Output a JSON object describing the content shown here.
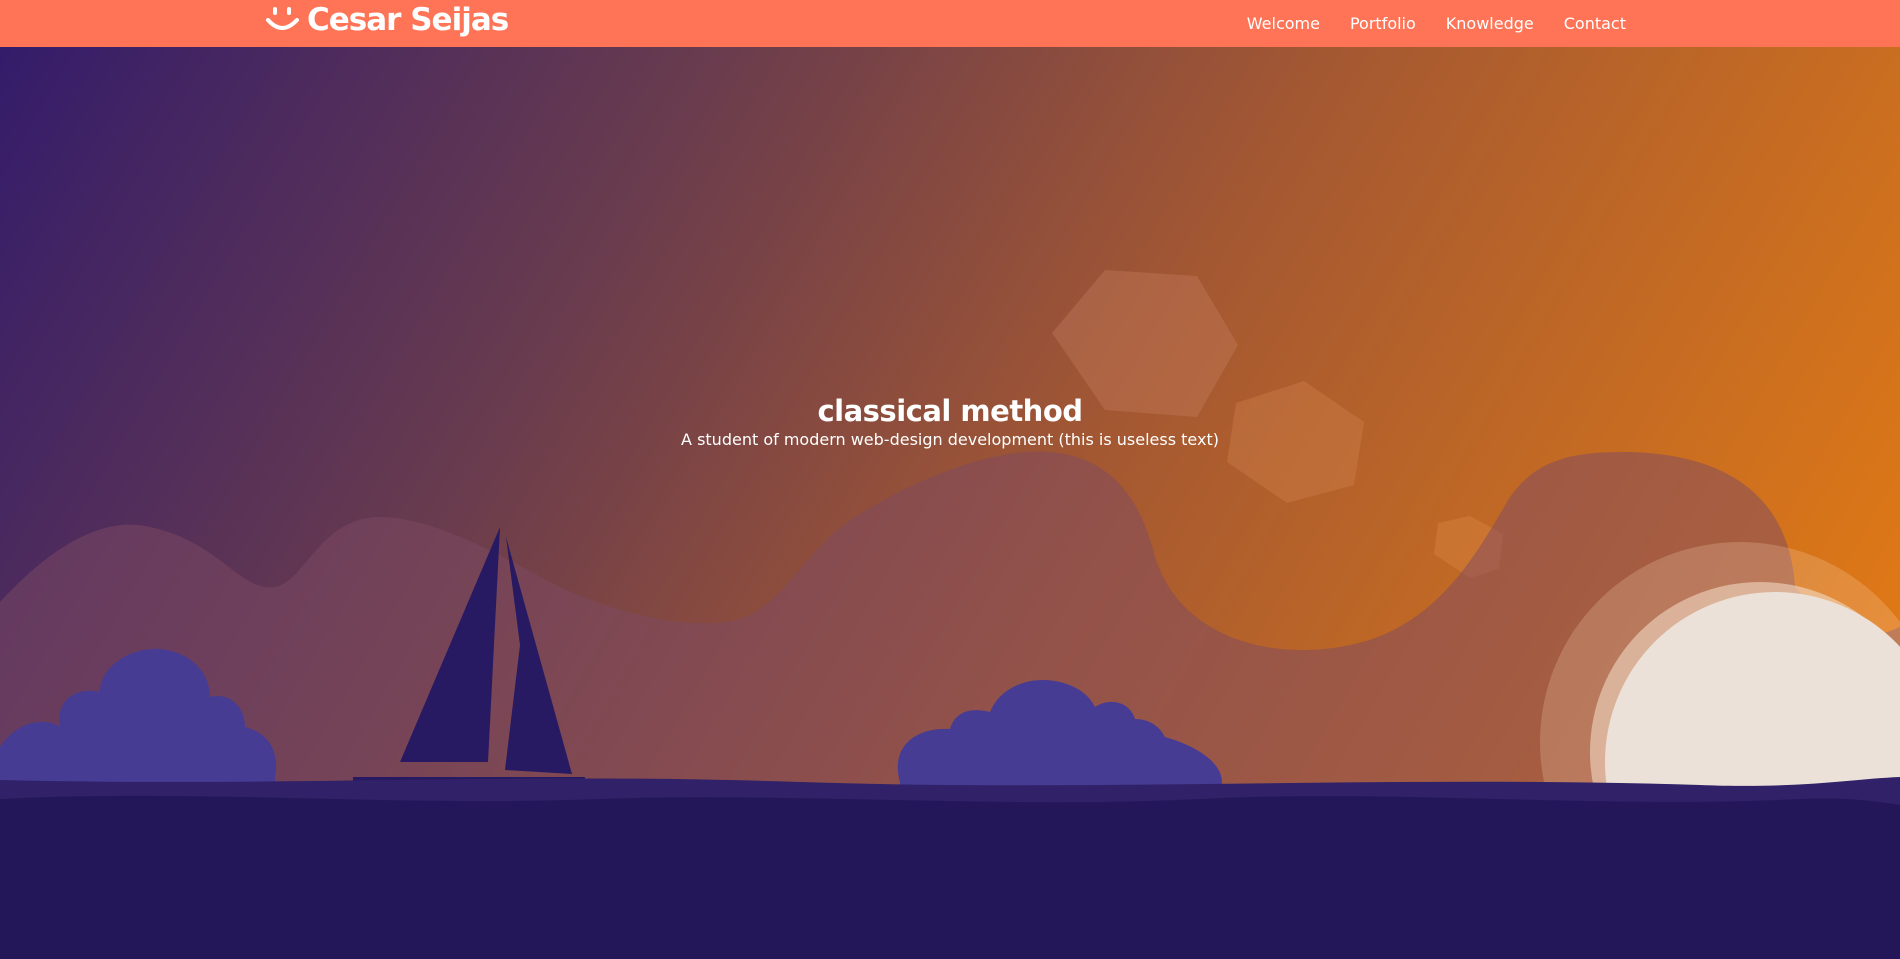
{
  "brand": {
    "name": "Cesar Seijas",
    "logo_icon": "smiley-icon"
  },
  "nav": {
    "items": [
      {
        "label": "Welcome"
      },
      {
        "label": "Portfolio"
      },
      {
        "label": "Knowledge"
      },
      {
        "label": "Contact"
      }
    ]
  },
  "hero": {
    "title": "classical method",
    "subtitle": "A student of modern web-design development (this is useless text)"
  },
  "colors": {
    "navbar": "#ff7457",
    "gradient_start": "#341c6b",
    "gradient_end": "#ec7e10",
    "hills": "#7e4a63",
    "clouds": "#463c94",
    "sailboat": "#281a62",
    "water": "#241759",
    "sun": "#ebe1d8"
  }
}
